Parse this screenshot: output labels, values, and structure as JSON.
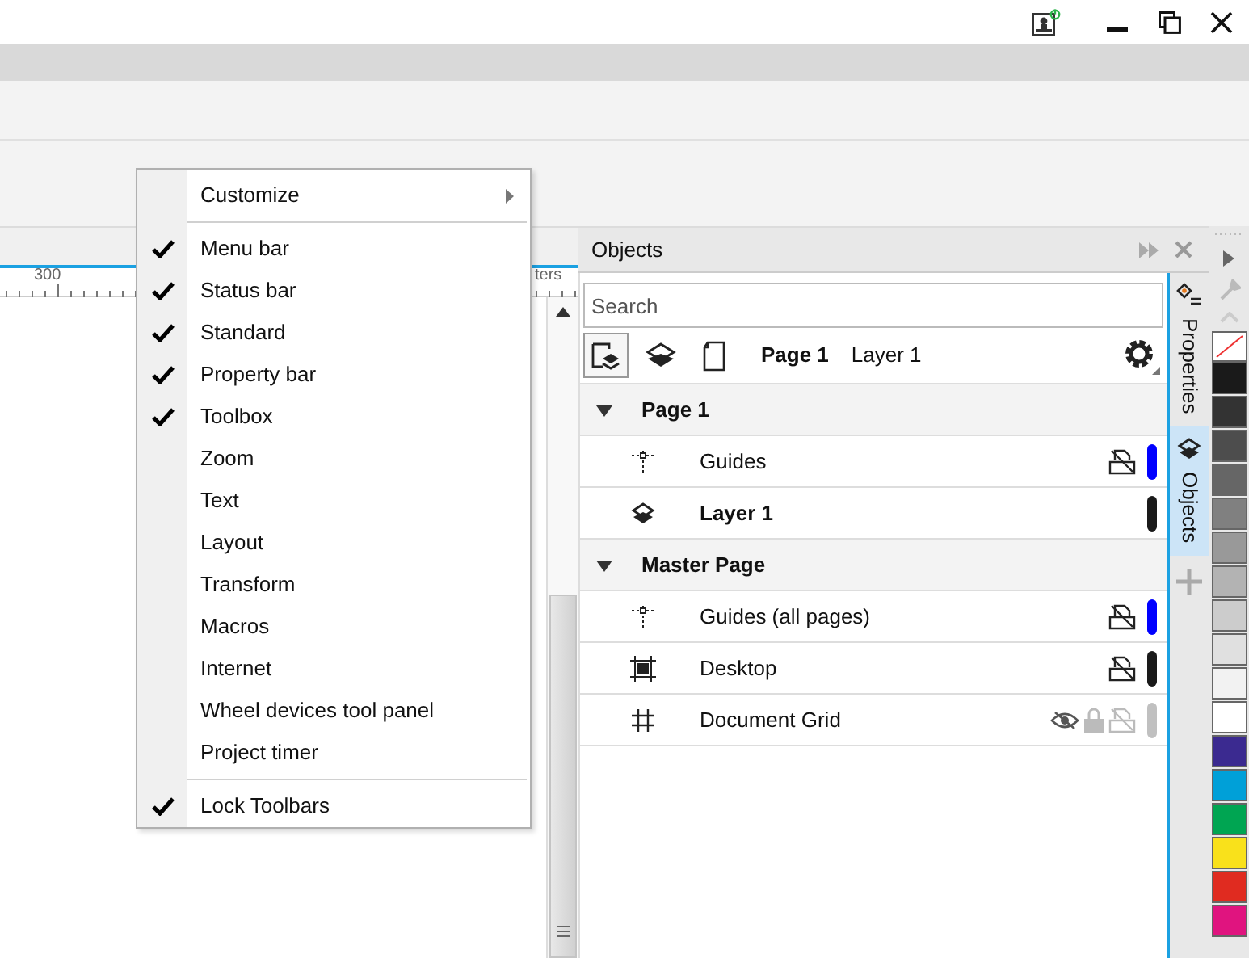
{
  "title_bar": {
    "buttons": [
      {
        "kind": "user"
      },
      {
        "kind": "minimize"
      },
      {
        "kind": "restore"
      },
      {
        "kind": "close"
      }
    ]
  },
  "ruler": {
    "labels": [
      "300",
      "ters"
    ]
  },
  "context_menu": {
    "groups": [
      [
        {
          "label": "Customize",
          "kind": "submenu",
          "checked": false
        }
      ],
      [
        {
          "label": "Menu bar",
          "kind": "toggle",
          "checked": true
        },
        {
          "label": "Status bar",
          "kind": "toggle",
          "checked": true
        },
        {
          "label": "Standard",
          "kind": "toggle",
          "checked": true
        },
        {
          "label": "Property bar",
          "kind": "toggle",
          "checked": true
        },
        {
          "label": "Toolbox",
          "kind": "toggle",
          "checked": true
        },
        {
          "label": "Zoom",
          "kind": "toggle",
          "checked": false
        },
        {
          "label": "Text",
          "kind": "toggle",
          "checked": false
        },
        {
          "label": "Layout",
          "kind": "toggle",
          "checked": false
        },
        {
          "label": "Transform",
          "kind": "toggle",
          "checked": false
        },
        {
          "label": "Macros",
          "kind": "toggle",
          "checked": false
        },
        {
          "label": "Internet",
          "kind": "toggle",
          "checked": false
        },
        {
          "label": "Wheel devices tool panel",
          "kind": "toggle",
          "checked": false
        },
        {
          "label": "Project timer",
          "kind": "toggle",
          "checked": false
        }
      ],
      [
        {
          "label": "Lock Toolbars",
          "kind": "toggle",
          "checked": true
        }
      ]
    ]
  },
  "objects_panel": {
    "title": "Objects",
    "search": {
      "placeholder": "Search"
    },
    "toolbar": {
      "views": [
        {
          "kind": "pages-layers",
          "selected": true
        },
        {
          "kind": "layers",
          "selected": false
        },
        {
          "kind": "page",
          "selected": false
        }
      ],
      "page": "Page 1",
      "layer": "Layer 1"
    },
    "tree": [
      {
        "label": "Page 1",
        "expanded": true,
        "children": [
          {
            "label": "Guides",
            "kind": "guides",
            "bold": false,
            "print_toggle": true,
            "hidden": false,
            "color": "#0000ff"
          },
          {
            "label": "Layer 1",
            "kind": "layer",
            "bold": true,
            "print_toggle": false,
            "hidden": false,
            "color": "#1a1a1a"
          }
        ]
      },
      {
        "label": "Master Page",
        "expanded": true,
        "children": [
          {
            "label": "Guides (all pages)",
            "kind": "guides",
            "bold": false,
            "print_toggle": true,
            "hidden": false,
            "color": "#0000ff"
          },
          {
            "label": "Desktop",
            "kind": "desktop",
            "bold": false,
            "print_toggle": true,
            "hidden": false,
            "color": "#1a1a1a"
          },
          {
            "label": "Document Grid",
            "kind": "grid",
            "bold": false,
            "print_toggle": true,
            "hidden": true,
            "color": "#c0c0c0"
          }
        ]
      }
    ]
  },
  "side_tabs": [
    {
      "label": "Properties",
      "kind": "properties",
      "selected": false
    },
    {
      "label": "Objects",
      "kind": "objects",
      "selected": true
    }
  ],
  "palette": {
    "swatches": [
      {
        "color": "#1a1a1a"
      },
      {
        "color": "#333333"
      },
      {
        "color": "#4d4d4d"
      },
      {
        "color": "#666666"
      },
      {
        "color": "#808080"
      },
      {
        "color": "#999999"
      },
      {
        "color": "#b3b3b3"
      },
      {
        "color": "#cccccc"
      },
      {
        "color": "#e0e0e0"
      },
      {
        "color": "#f2f2f2"
      },
      {
        "color": "#ffffff"
      },
      {
        "color": "#3b2a90"
      },
      {
        "color": "#00a0d8"
      },
      {
        "color": "#00a552"
      },
      {
        "color": "#f9e11b"
      },
      {
        "color": "#e02b20"
      },
      {
        "color": "#e0147f"
      }
    ]
  }
}
